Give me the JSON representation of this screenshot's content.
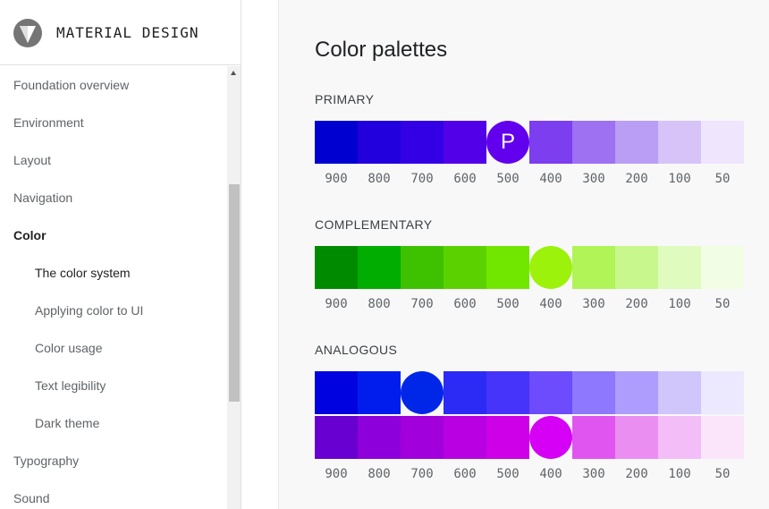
{
  "brand": {
    "title": "MATERIAL DESIGN",
    "logo_icon": "material-logo-icon"
  },
  "sidebar": {
    "items": [
      {
        "label": "Foundation overview",
        "level": 0,
        "state": ""
      },
      {
        "label": "Environment",
        "level": 0,
        "state": ""
      },
      {
        "label": "Layout",
        "level": 0,
        "state": ""
      },
      {
        "label": "Navigation",
        "level": 0,
        "state": ""
      },
      {
        "label": "Color",
        "level": 0,
        "state": "active"
      },
      {
        "label": "The color system",
        "level": 1,
        "state": "current"
      },
      {
        "label": "Applying color to UI",
        "level": 1,
        "state": ""
      },
      {
        "label": "Color usage",
        "level": 1,
        "state": ""
      },
      {
        "label": "Text legibility",
        "level": 1,
        "state": ""
      },
      {
        "label": "Dark theme",
        "level": 1,
        "state": ""
      },
      {
        "label": "Typography",
        "level": 0,
        "state": ""
      },
      {
        "label": "Sound",
        "level": 0,
        "state": ""
      }
    ]
  },
  "main": {
    "title": "Color palettes",
    "shade_labels": [
      "900",
      "800",
      "700",
      "600",
      "500",
      "400",
      "300",
      "200",
      "100",
      "50"
    ],
    "sections": {
      "primary": {
        "title": "PRIMARY",
        "key_label": "P",
        "colors": [
          "#0000d0",
          "#2100dd",
          "#3300e5",
          "#5200e8",
          "#6200ee",
          "#7c3eef",
          "#9d71f2",
          "#ba9df4",
          "#d7c3f7",
          "#efe5fd"
        ],
        "key_index": 4
      },
      "complementary": {
        "title": "COMPLEMENTARY",
        "colors": [
          "#008a00",
          "#00ad00",
          "#3ec200",
          "#5bd200",
          "#71e700",
          "#9cf20a",
          "#b0f457",
          "#c7f78d",
          "#dffbbe",
          "#f2fde5"
        ],
        "key_index": 5
      },
      "analogous": {
        "title": "ANALOGOUS",
        "rows": [
          {
            "colors": [
              "#0003e0",
              "#001ded",
              "#0027e8",
              "#2c2bf5",
              "#4634fb",
              "#6c4cfc",
              "#8e78fd",
              "#ae9dfc",
              "#d0c6fc",
              "#ece9fe"
            ],
            "key_index": 2
          },
          {
            "colors": [
              "#6700d0",
              "#8e00db",
              "#a100dc",
              "#b800e3",
              "#cd00e7",
              "#d500f5",
              "#e055f0",
              "#ea8ff1",
              "#f3bdf8",
              "#fbe5fb"
            ],
            "key_index": 5
          }
        ]
      }
    }
  }
}
